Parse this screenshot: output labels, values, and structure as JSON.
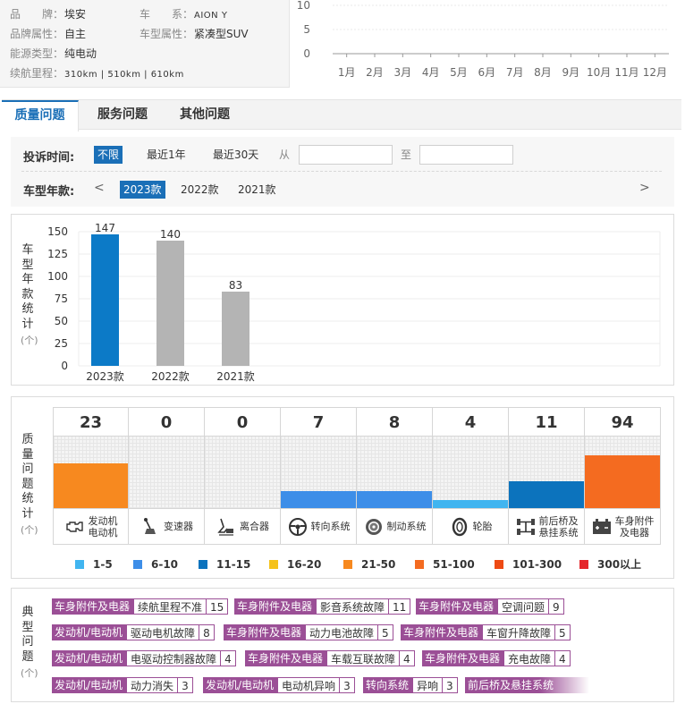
{
  "car_info": {
    "brand_label": "品　　牌：",
    "brand": "埃安",
    "series_label": "车　　系：",
    "series": "AION Y",
    "brand_type_label": "品牌属性：",
    "brand_type": "自主",
    "model_type_label": "车型属性：",
    "model_type": "紧凑型SUV",
    "energy_label": "能源类型：",
    "energy": "纯电动",
    "range_label": "续航里程：",
    "range": "310km | 510km | 610km"
  },
  "monthly_chart": {
    "y_ticks": [
      "10",
      "5",
      "0"
    ],
    "months": [
      "1月",
      "2月",
      "3月",
      "4月",
      "5月",
      "6月",
      "7月",
      "8月",
      "9月",
      "10月",
      "11月",
      "12月"
    ]
  },
  "tabs": [
    {
      "label": "质量问题",
      "active": true
    },
    {
      "label": "服务问题",
      "active": false
    },
    {
      "label": "其他问题",
      "active": false
    }
  ],
  "filters": {
    "time_label": "投诉时间:",
    "time_options": [
      {
        "label": "不限",
        "active": true
      },
      {
        "label": "最近1年",
        "active": false
      },
      {
        "label": "最近30天",
        "active": false
      }
    ],
    "from_label": "从",
    "to_label": "至",
    "year_label": "车型年款:",
    "prev_arrow": "<",
    "next_arrow": ">",
    "year_options": [
      {
        "label": "2023款",
        "active": true
      },
      {
        "label": "2022款",
        "active": false
      },
      {
        "label": "2021款",
        "active": false
      }
    ]
  },
  "year_chart_label": [
    "车",
    "型",
    "年",
    "款",
    "统",
    "计"
  ],
  "year_chart_unit": "(个)",
  "chart_data": {
    "type": "bar",
    "categories": [
      "2023款",
      "2022款",
      "2021款"
    ],
    "values": [
      147,
      140,
      83
    ],
    "ylim": [
      0,
      150
    ],
    "y_ticks": [
      0,
      25,
      50,
      75,
      100,
      125,
      150
    ],
    "colors": [
      "#0c7ac7",
      "#b4b4b4",
      "#b4b4b4"
    ],
    "grid": true,
    "title": "",
    "xlabel": "",
    "ylabel": ""
  },
  "quality_label": [
    "质",
    "量",
    "问",
    "题",
    "统",
    "计"
  ],
  "quality_unit": "(个)",
  "quality_stats": [
    {
      "count": "23",
      "name": [
        "发动机",
        "电动机"
      ],
      "icon": "engine-icon",
      "color": "#f7891f",
      "level": 0.62
    },
    {
      "count": "0",
      "name": [
        "变速器"
      ],
      "icon": "gear-shift-icon",
      "color": "",
      "level": 0
    },
    {
      "count": "0",
      "name": [
        "离合器"
      ],
      "icon": "clutch-pedal-icon",
      "color": "",
      "level": 0
    },
    {
      "count": "7",
      "name": [
        "转向系统"
      ],
      "icon": "steering-wheel-icon",
      "color": "#3d8ee8",
      "level": 0.24
    },
    {
      "count": "8",
      "name": [
        "制动系统"
      ],
      "icon": "brake-disc-icon",
      "color": "#3d8ee8",
      "level": 0.24
    },
    {
      "count": "4",
      "name": [
        "轮胎"
      ],
      "icon": "tire-icon",
      "color": "#41b5f0",
      "level": 0.11
    },
    {
      "count": "11",
      "name": [
        "前后桥及",
        "悬挂系统"
      ],
      "icon": "axle-icon",
      "color": "#0c73bd",
      "level": 0.37
    },
    {
      "count": "94",
      "name": [
        "车身附件",
        "及电器"
      ],
      "icon": "battery-icon",
      "color": "#f46b20",
      "level": 0.74
    }
  ],
  "legend": [
    {
      "label": "1-5",
      "color": "#41b5f0"
    },
    {
      "label": "6-10",
      "color": "#3d8ee8"
    },
    {
      "label": "11-15",
      "color": "#0c73bd"
    },
    {
      "label": "16-20",
      "color": "#f5c21a"
    },
    {
      "label": "21-50",
      "color": "#f7891f"
    },
    {
      "label": "51-100",
      "color": "#f46b20"
    },
    {
      "label": "101-300",
      "color": "#ee4a14"
    },
    {
      "label": "300以上",
      "color": "#e5262b"
    }
  ],
  "typical_label": [
    "典",
    "型",
    "问",
    "题"
  ],
  "typical_unit": "(个)",
  "typical_issues": [
    [
      {
        "cat": "车身附件及电器",
        "issue": "续航里程不准",
        "count": "15"
      },
      {
        "cat": "车身附件及电器",
        "issue": "影音系统故障",
        "count": "11"
      },
      {
        "cat": "车身附件及电器",
        "issue": "空调问题",
        "count": "9"
      }
    ],
    [
      {
        "cat": "发动机/电动机",
        "issue": "驱动电机故障",
        "count": "8"
      },
      {
        "cat": "车身附件及电器",
        "issue": "动力电池故障",
        "count": "5"
      },
      {
        "cat": "车身附件及电器",
        "issue": "车窗升降故障",
        "count": "5"
      }
    ],
    [
      {
        "cat": "发动机/电动机",
        "issue": "电驱动控制器故障",
        "count": "4"
      },
      {
        "cat": "车身附件及电器",
        "issue": "车载互联故障",
        "count": "4"
      },
      {
        "cat": "车身附件及电器",
        "issue": "充电故障",
        "count": "4"
      }
    ],
    [
      {
        "cat": "发动机/电动机",
        "issue": "动力消失",
        "count": "3"
      },
      {
        "cat": "发动机/电动机",
        "issue": "电动机异响",
        "count": "3"
      },
      {
        "cat": "转向系统",
        "issue": "异响",
        "count": "3"
      },
      {
        "cat": "前后桥及悬挂系统",
        "issue": "",
        "count": ""
      }
    ]
  ]
}
